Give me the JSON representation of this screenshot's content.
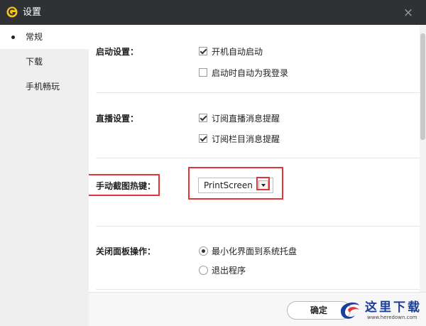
{
  "window": {
    "title": "设置",
    "close_glyph": "×",
    "accent": "#2f3134",
    "logo_icon": "app-logo-icon"
  },
  "sidebar": {
    "items": [
      {
        "label": "常规",
        "active": true
      },
      {
        "label": "下载",
        "active": false
      },
      {
        "label": "手机畅玩",
        "active": false
      }
    ]
  },
  "startup": {
    "label": "启动设置：",
    "options": [
      {
        "label": "开机自动启动",
        "checked": true
      },
      {
        "label": "启动时自动为我登录",
        "checked": false
      }
    ]
  },
  "live": {
    "label": "直播设置：",
    "options": [
      {
        "label": "订阅直播消息提醒",
        "checked": true
      },
      {
        "label": "订阅栏目消息提醒",
        "checked": true
      }
    ]
  },
  "hotkey": {
    "label": "手动截图热键：",
    "value": "PrintScreen"
  },
  "close_panel": {
    "label": "关闭面板操作：",
    "options": [
      {
        "label": "最小化界面到系统托盘",
        "selected": true
      },
      {
        "label": "退出程序",
        "selected": false
      }
    ]
  },
  "footer": {
    "ok_label": "确定"
  },
  "watermark": {
    "text": "这里下载",
    "url": "www.heredown.com",
    "icon": "watermark-logo-icon"
  },
  "colors": {
    "highlight": "#e53438",
    "watermark": "#1a3f9a"
  }
}
